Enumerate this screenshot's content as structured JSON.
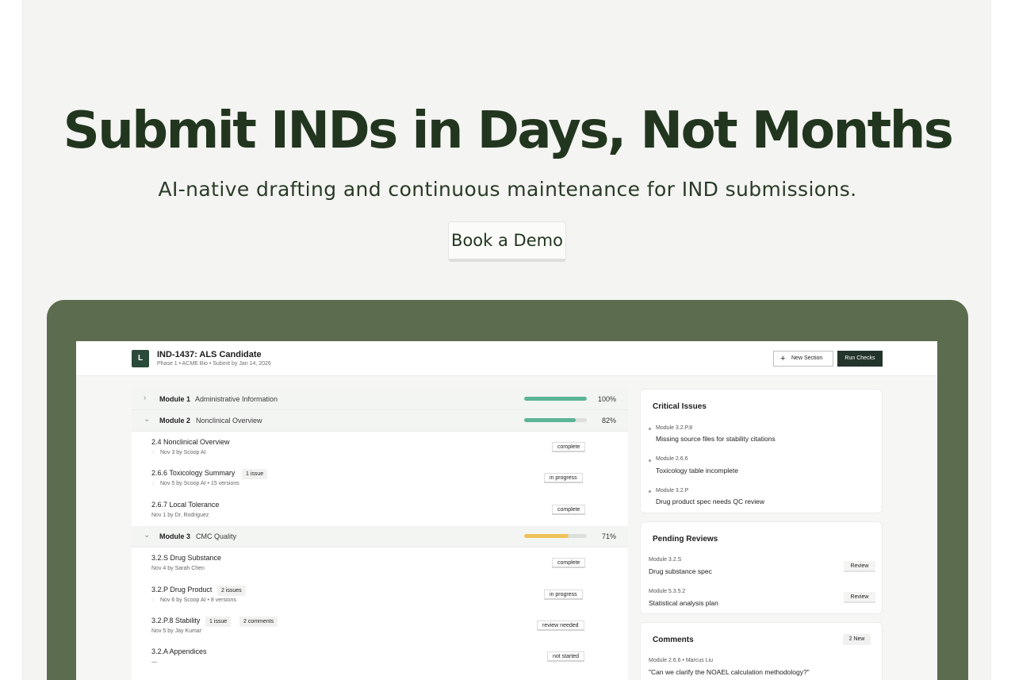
{
  "hero": {
    "title": "Submit INDs in Days, Not Months",
    "subtitle": "AI-native drafting and continuous maintenance for IND submissions.",
    "cta_label": "Book a Demo"
  },
  "app": {
    "logo_letter": "L",
    "project_title": "IND-1437: ALS Candidate",
    "project_meta": "Phase 1 • ACME Bio • Submit by Jan 14, 2026",
    "new_section_label": "New Section",
    "run_checks_label": "Run Checks",
    "modules": [
      {
        "name": "Module 1",
        "desc": "Administrative Information",
        "progress": 1.0,
        "pct": "100%",
        "color": "#5bb496",
        "expanded": false
      },
      {
        "name": "Module 2",
        "desc": "Nonclinical Overview",
        "progress": 0.82,
        "pct": "82%",
        "color": "#5bb496",
        "expanded": true
      },
      {
        "name": "Module 3",
        "desc": "CMC Quality",
        "progress": 0.71,
        "pct": "71%",
        "color": "#efc35a",
        "expanded": true
      }
    ],
    "sections": [
      {
        "name": "2.4 Nonclinical Overview",
        "meta": "Nov 3 by Scoop AI",
        "pin": true,
        "tags": [],
        "status": "complete"
      },
      {
        "name": "2.6.6 Toxicology Summary",
        "meta": "Nov 5 by Scoop AI • 15 versions",
        "pin": true,
        "tags": [
          "1 issue"
        ],
        "status": "in progress"
      },
      {
        "name": "2.6.7 Local Tolerance",
        "meta": "Nov 1 by Dr. Rodriguez",
        "pin": false,
        "tags": [],
        "status": "complete"
      },
      {
        "name": "3.2.S Drug Substance",
        "meta": "Nov 4 by Sarah Chen",
        "pin": false,
        "tags": [],
        "status": "complete"
      },
      {
        "name": "3.2.P Drug Product",
        "meta": "Nov 6 by Scoop AI • 8 versions",
        "pin": true,
        "tags": [
          "2 issues"
        ],
        "status": "in progress"
      },
      {
        "name": "3.2.P.8 Stability",
        "meta": "Nov 5 by Jay Kumar",
        "pin": false,
        "tags": [
          "1 issue",
          "2 comments"
        ],
        "status": "review needed"
      },
      {
        "name": "3.2.A Appendices",
        "meta": "—",
        "pin": false,
        "tags": [],
        "status": "not started"
      }
    ],
    "critical_issues": {
      "title": "Critical Issues",
      "items": [
        {
          "module": "Module 3.2.P.8",
          "text": "Missing source files for stability citations"
        },
        {
          "module": "Module 2.6.6",
          "text": "Toxicology table incomplete"
        },
        {
          "module": "Module 3.2.P",
          "text": "Drug product spec needs QC review"
        }
      ]
    },
    "pending_reviews": {
      "title": "Pending Reviews",
      "button_label": "Review",
      "items": [
        {
          "module": "Module 3.2.S",
          "text": "Drug substance spec"
        },
        {
          "module": "Module 5.3.5.2",
          "text": "Statistical analysis plan"
        }
      ]
    },
    "comments": {
      "title": "Comments",
      "badge": "2 New",
      "items": [
        {
          "meta": "Module 2.6.6 • Marcus Liu",
          "text": "\"Can we clarify the NOAEL calculation methodology?\""
        }
      ]
    }
  }
}
